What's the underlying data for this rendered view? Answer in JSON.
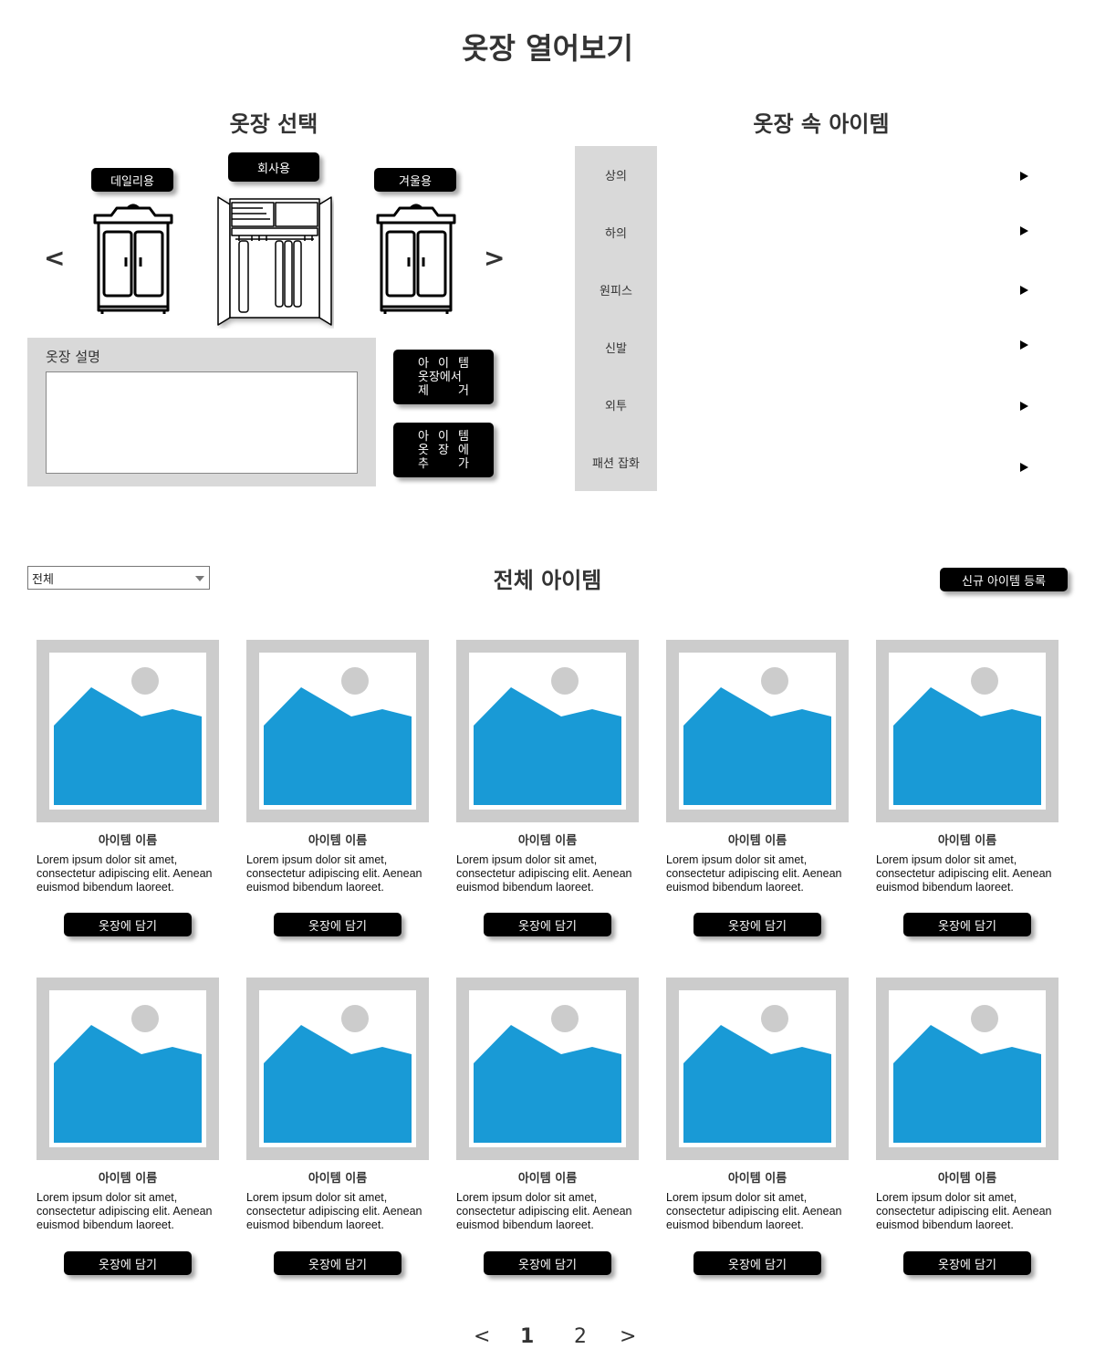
{
  "page_title": "옷장 열어보기",
  "closet_select": {
    "title": "옷장 선택",
    "prev_label": "<",
    "next_label": ">",
    "closets": [
      {
        "label": "데일리용"
      },
      {
        "label": "회사용"
      },
      {
        "label": "겨울용"
      }
    ]
  },
  "description": {
    "label": "옷장 설명",
    "value": ""
  },
  "actions": {
    "remove_lines": [
      "아 이 템",
      "옷장에서",
      "제 거"
    ],
    "add_lines": [
      "아 이 템",
      "옷 장 에",
      "추 가"
    ]
  },
  "closet_items": {
    "title": "옷장 속 아이템",
    "categories": [
      {
        "label": "상의"
      },
      {
        "label": "하의"
      },
      {
        "label": "원피스"
      },
      {
        "label": "신발"
      },
      {
        "label": "외투"
      },
      {
        "label": "패션 잡화"
      }
    ]
  },
  "all_items": {
    "title": "전체 아이템",
    "filter_value": "전체",
    "register_label": "신규 아이템 등록",
    "items": [
      {
        "name": "아이템 이름",
        "desc": "Lorem ipsum dolor sit amet, consectetur adipiscing elit. Aenean euismod bibendum laoreet.",
        "button": "옷장에 담기"
      },
      {
        "name": "아이템 이름",
        "desc": "Lorem ipsum dolor sit amet, consectetur adipiscing elit. Aenean euismod bibendum laoreet.",
        "button": "옷장에 담기"
      },
      {
        "name": "아이템 이름",
        "desc": "Lorem ipsum dolor sit amet, consectetur adipiscing elit. Aenean euismod bibendum laoreet.",
        "button": "옷장에 담기"
      },
      {
        "name": "아이템 이름",
        "desc": "Lorem ipsum dolor sit amet, consectetur adipiscing elit. Aenean euismod bibendum laoreet.",
        "button": "옷장에 담기"
      },
      {
        "name": "아이템 이름",
        "desc": "Lorem ipsum dolor sit amet, consectetur adipiscing elit. Aenean euismod bibendum laoreet.",
        "button": "옷장에 담기"
      },
      {
        "name": "아이템 이름",
        "desc": "Lorem ipsum dolor sit amet, consectetur adipiscing elit. Aenean euismod bibendum laoreet.",
        "button": "옷장에 담기"
      },
      {
        "name": "아이템 이름",
        "desc": "Lorem ipsum dolor sit amet, consectetur adipiscing elit. Aenean euismod bibendum laoreet.",
        "button": "옷장에 담기"
      },
      {
        "name": "아이템 이름",
        "desc": "Lorem ipsum dolor sit amet, consectetur adipiscing elit. Aenean euismod bibendum laoreet.",
        "button": "옷장에 담기"
      },
      {
        "name": "아이템 이름",
        "desc": "Lorem ipsum dolor sit amet, consectetur adipiscing elit. Aenean euismod bibendum laoreet.",
        "button": "옷장에 담기"
      },
      {
        "name": "아이템 이름",
        "desc": "Lorem ipsum dolor sit amet, consectetur adipiscing elit. Aenean euismod bibendum laoreet.",
        "button": "옷장에 담기"
      }
    ]
  },
  "pagination": {
    "prev": "<",
    "pages": [
      "1",
      "2"
    ],
    "current": "1",
    "next": ">"
  },
  "colors": {
    "accent_blue": "#199ad6",
    "panel_gray": "#d9d9d9",
    "placeholder_gray": "#cccccc",
    "button_black": "#000000"
  }
}
